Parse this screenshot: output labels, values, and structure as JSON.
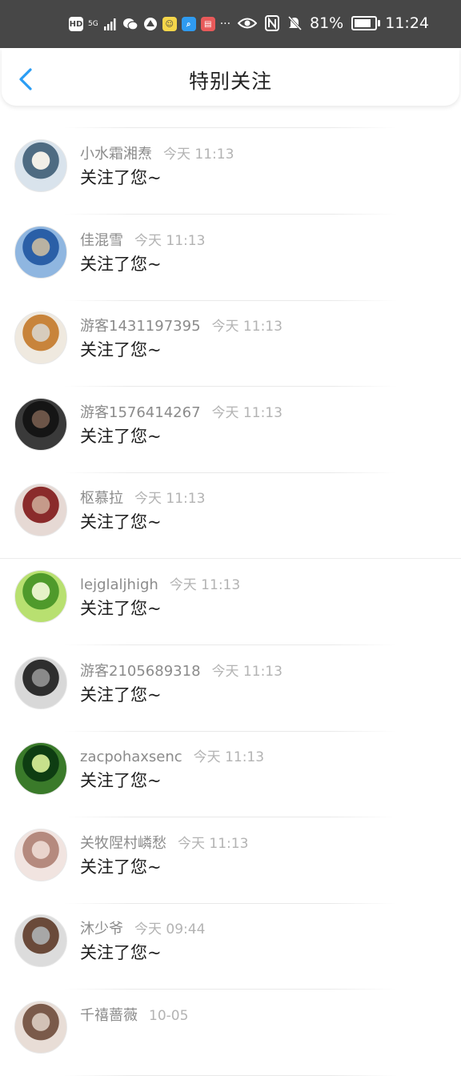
{
  "status_bar": {
    "left_icons": [
      "HD",
      "5G",
      "signal-bars-icon",
      "wechat-icon",
      "app-icon",
      "qq-icon",
      "search-app-icon",
      "reader-app-icon",
      "more-dots-icon"
    ],
    "hd_label": "HD",
    "net_label": "5G",
    "more_label": "···",
    "battery_percent": "81%",
    "battery_level": 0.81,
    "time": "11:24"
  },
  "header": {
    "title": "特别关注"
  },
  "items": [
    {
      "name": "小水霜湘焘",
      "time": "今天 11:13",
      "message": "关注了您~",
      "avatar_colors": [
        "#d9e3ec",
        "#4e6b82",
        "#f2efe8"
      ]
    },
    {
      "name": "佳混雪",
      "time": "今天 11:13",
      "message": "关注了您~",
      "avatar_colors": [
        "#8fb6e0",
        "#2a5fa7",
        "#b9b2a2"
      ]
    },
    {
      "name": "游客1431197395",
      "time": "今天 11:13",
      "message": "关注了您~",
      "avatar_colors": [
        "#efe9df",
        "#c8843b",
        "#d7ccbd"
      ]
    },
    {
      "name": "游客1576414267",
      "time": "今天 11:13",
      "message": "关注了您~",
      "avatar_colors": [
        "#3a3a3a",
        "#151515",
        "#6c5548"
      ]
    },
    {
      "name": "枢慕拉",
      "time": "今天 11:13",
      "message": "关注了您~",
      "avatar_colors": [
        "#e6d9d4",
        "#8a2b2b",
        "#c59a8a"
      ]
    },
    {
      "name": "lejglaljhigh",
      "time": "今天 11:13",
      "message": "关注了您~",
      "avatar_colors": [
        "#b8e070",
        "#4f9a2b",
        "#e6f2c8"
      ]
    },
    {
      "name": "游客2105689318",
      "time": "今天 11:13",
      "message": "关注了您~",
      "avatar_colors": [
        "#d8d8d8",
        "#2e2e2e",
        "#8a8a8a"
      ]
    },
    {
      "name": "zacpohaxsenc",
      "time": "今天 11:13",
      "message": "关注了您~",
      "avatar_colors": [
        "#3a7a2a",
        "#0e3d12",
        "#c7e08c"
      ]
    },
    {
      "name": "关牧陧村嶙愁",
      "time": "今天 11:13",
      "message": "关注了您~",
      "avatar_colors": [
        "#f1e4e0",
        "#b58a7e",
        "#e9d4cc"
      ]
    },
    {
      "name": "沐少爷",
      "time": "今天 09:44",
      "message": "关注了您~",
      "avatar_colors": [
        "#dcdcdc",
        "#6a4a3a",
        "#a7a7a7"
      ]
    },
    {
      "name": "千禧蔷薇",
      "time": "10-05",
      "message": "",
      "avatar_colors": [
        "#e8ddd6",
        "#7a5a4a",
        "#d2c2b6"
      ]
    }
  ]
}
